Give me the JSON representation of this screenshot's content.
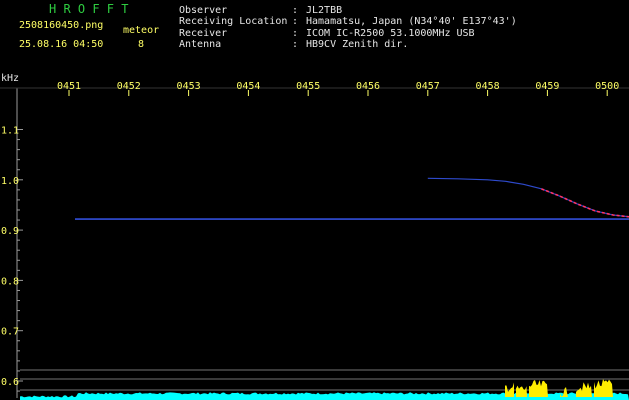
{
  "app": {
    "title": "H R O F F T",
    "filename": "2508160450.png",
    "datetime": "25.08.16 04:50",
    "count_label": "meteor",
    "count_value": "8"
  },
  "info": {
    "rows": [
      {
        "key": "Observer",
        "sep": ":",
        "value": "JL2TBB"
      },
      {
        "key": "Receiving Location",
        "sep": ":",
        "value": "Hamamatsu, Japan (N34°40' E137°43')"
      },
      {
        "key": "Receiver",
        "sep": ":",
        "value": "ICOM IC-R2500 53.1000MHz USB"
      },
      {
        "key": "Antenna",
        "sep": ":",
        "value": "HB9CV Zenith dir."
      }
    ]
  },
  "colors": {
    "text_yellow": "#ffff66",
    "title_green": "#2ecc40",
    "grid_gray": "#9a9a9a",
    "trace_blue": "#3a5cff",
    "meteor_head": "#ff3366",
    "noise_cyan": "#00ffff",
    "signal_yellow": "#ffee00"
  },
  "chart_data": {
    "type": "line",
    "y_unit": "kHz",
    "time_ticks": [
      "0451",
      "0452",
      "0453",
      "0454",
      "0455",
      "0456",
      "0457",
      "0458",
      "0459",
      "0500"
    ],
    "freq_ticks": [
      "1.1",
      "1.0",
      "0.9",
      "0.8",
      "0.7",
      "0.6"
    ],
    "ylim": [
      0.6,
      1.1
    ],
    "series": [
      {
        "time_min": [
          0.1,
          9.9
        ],
        "freq_khz": [
          0.922,
          0.922
        ]
      },
      {
        "time_min": [
          6.0,
          6.5,
          7.0,
          7.3,
          7.6,
          7.9,
          8.2,
          8.5,
          8.8,
          9.1,
          9.4,
          9.7,
          9.9
        ],
        "freq_khz": [
          1.003,
          1.002,
          1.0,
          0.997,
          0.991,
          0.982,
          0.968,
          0.952,
          0.938,
          0.93,
          0.926,
          0.923,
          0.92
        ]
      }
    ]
  }
}
